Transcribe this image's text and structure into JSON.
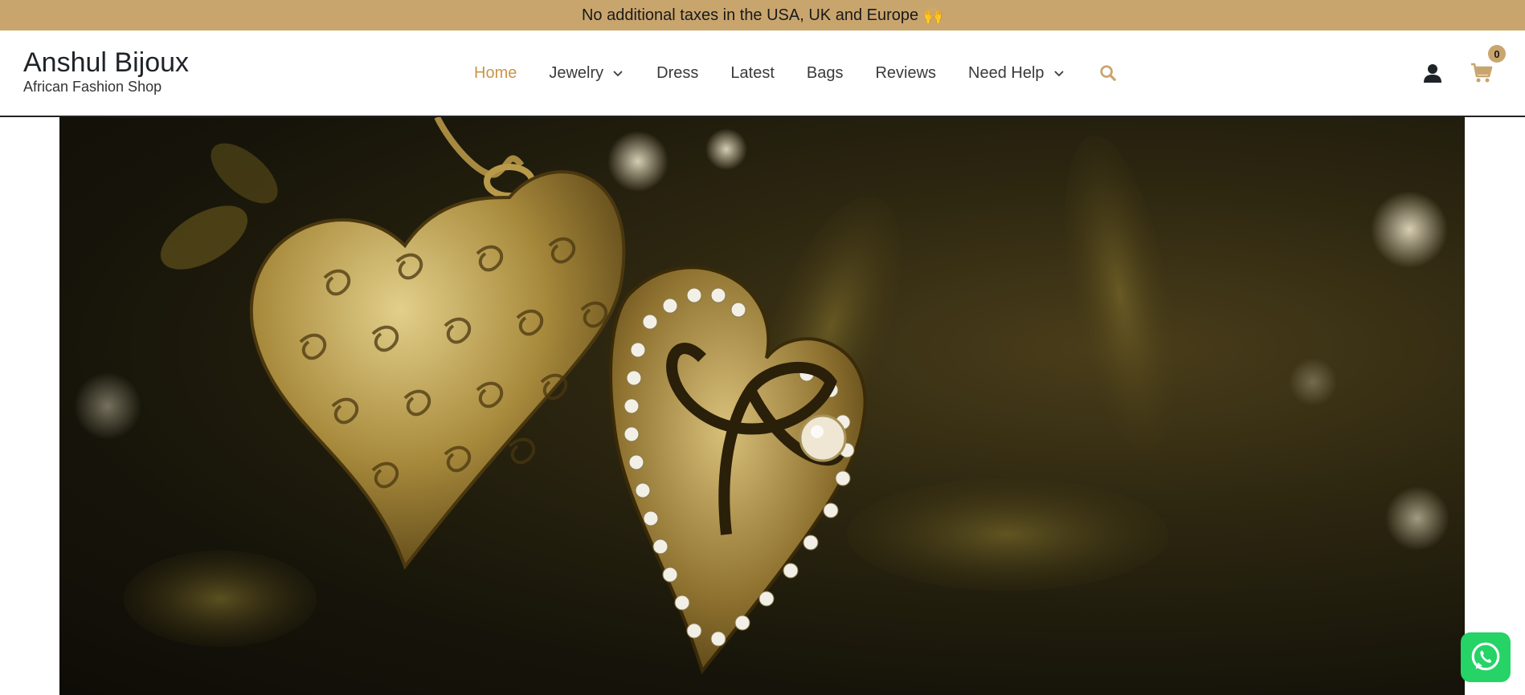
{
  "announcement": {
    "text": "No additional taxes in the USA, UK and Europe",
    "emoji": "🙌"
  },
  "brand": {
    "title": "Anshul Bijoux",
    "subtitle": "African Fashion Shop"
  },
  "nav": {
    "items": [
      {
        "label": "Home",
        "active": true,
        "dropdown": false
      },
      {
        "label": "Jewelry",
        "active": false,
        "dropdown": true
      },
      {
        "label": "Dress",
        "active": false,
        "dropdown": false
      },
      {
        "label": "Latest",
        "active": false,
        "dropdown": false
      },
      {
        "label": "Bags",
        "active": false,
        "dropdown": false
      },
      {
        "label": "Reviews",
        "active": false,
        "dropdown": false
      },
      {
        "label": "Need Help",
        "active": false,
        "dropdown": true
      }
    ],
    "search_icon": "search-icon"
  },
  "header_right": {
    "account_icon": "user-icon",
    "cart_icon": "shopping-cart-icon",
    "cart_count": "0"
  },
  "hero": {
    "image": "golden heart locket with pearl and rhinestones"
  },
  "whatsapp": {
    "icon": "whatsapp-icon"
  },
  "colors": {
    "accent": "#c9a56e",
    "nav_active": "#c9954c",
    "whatsapp": "#25d366"
  }
}
